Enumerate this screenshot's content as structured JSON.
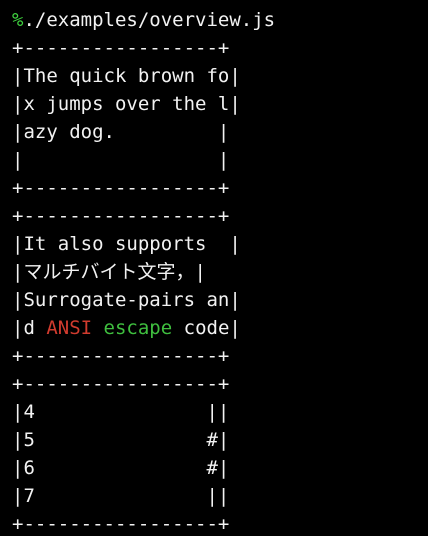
{
  "colors": {
    "background": "#000000",
    "text": "#f2f2f2",
    "prompt": "#3fd13f",
    "ansi_red": "#d13b2e",
    "ansi_green": "#3fbf3f"
  },
  "prompt": {
    "symbol": "%",
    "command": "./examples/overview.js"
  },
  "lines": [
    [
      {
        "text": "+-----------------+"
      }
    ],
    [
      {
        "text": "|The quick brown fo|"
      }
    ],
    [
      {
        "text": "|x jumps over the l|"
      }
    ],
    [
      {
        "text": "|azy dog.         |"
      }
    ],
    [
      {
        "text": "|                 |"
      }
    ],
    [
      {
        "text": "+-----------------+"
      }
    ],
    [
      {
        "text": "+-----------------+"
      }
    ],
    [
      {
        "text": "|It also supports  |"
      }
    ],
    [
      {
        "text": "|マルチバイト文字，|"
      }
    ],
    [
      {
        "text": "|Surrogate-pairs an|"
      }
    ],
    [
      {
        "text": "|d "
      },
      {
        "text": "ANSI",
        "color": "#d13b2e"
      },
      {
        "text": " "
      },
      {
        "text": "escape",
        "color": "#3fbf3f"
      },
      {
        "text": " code|"
      }
    ],
    [
      {
        "text": "+-----------------+"
      }
    ],
    [
      {
        "text": "+-----------------+"
      }
    ],
    [
      {
        "text": "|4               ||"
      }
    ],
    [
      {
        "text": "|5               #|"
      }
    ],
    [
      {
        "text": "|6               #|"
      }
    ],
    [
      {
        "text": "|7               ||"
      }
    ],
    [
      {
        "text": "+-----------------+"
      }
    ]
  ]
}
